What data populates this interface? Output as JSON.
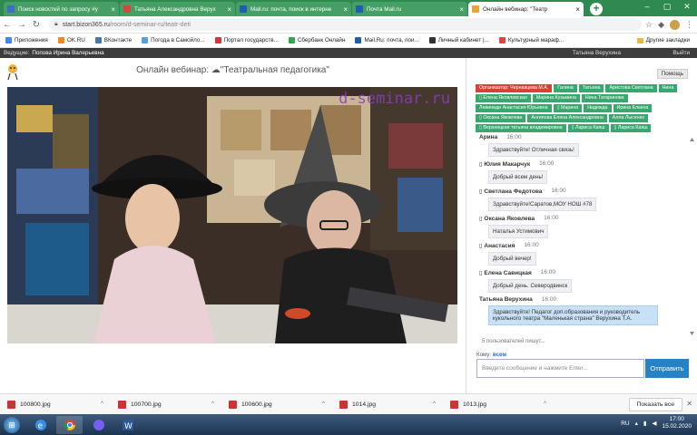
{
  "tabs": [
    {
      "label": "Поиск новостей по запросу #у",
      "color": "#3b6cc8",
      "active": false
    },
    {
      "label": "Татьяна Александровна Верух",
      "color": "#d44a3a",
      "active": false
    },
    {
      "label": "Mail.ru: почта, поиск в интерне",
      "color": "#1a5fb4",
      "active": false
    },
    {
      "label": "Почта Mail.ru",
      "color": "#1a5fb4",
      "active": false
    },
    {
      "label": "Онлайн вебинар: \"Театр",
      "color": "#e8a33a",
      "active": true
    }
  ],
  "address": {
    "host": "start.bizon365.ru",
    "path": "/room/d-seminar-ru/teatr-deti"
  },
  "bookmarks": [
    {
      "label": "Приложения",
      "color": "#4285f4"
    },
    {
      "label": "OK.RU",
      "color": "#f28a1e"
    },
    {
      "label": "ВКонтакте",
      "color": "#4a76a8"
    },
    {
      "label": "Погода в Самойло...",
      "color": "#5aa0d8"
    },
    {
      "label": "Портал государств...",
      "color": "#d33"
    },
    {
      "label": "Сбербанк Онлайн",
      "color": "#2fa84f"
    },
    {
      "label": "Mail.Ru: почта, пои...",
      "color": "#1a5fb4"
    },
    {
      "label": "Личный кабинет |...",
      "color": "#333"
    },
    {
      "label": "Культурный мараф...",
      "color": "#d44"
    }
  ],
  "other_bookmarks": "Другие закладки",
  "site": {
    "host_label": "Ведущие:",
    "host_name": "Попова Ирина Валерьевна",
    "user": "Татьяна Верухина",
    "exit": "Выйти"
  },
  "webinar_title": "Онлайн вебинар: ☁\"Театральная педагогика\"",
  "watermark": "d-seminar.ru",
  "chat": {
    "help": "Помощь",
    "participants": [
      {
        "label": "Организатор: Чернавцева М.А.",
        "org": true
      },
      {
        "label": "Галина"
      },
      {
        "label": "Татьяна"
      },
      {
        "label": "Аристова Светлана"
      },
      {
        "label": "Нина"
      },
      {
        "label": "▯ Елена Яковлевская"
      },
      {
        "label": "Марина Кузьмина"
      },
      {
        "label": "Нина Татаринова"
      },
      {
        "label": "Левиниди Анастасия Юрьевна"
      },
      {
        "label": "▯ Марина"
      },
      {
        "label": "Надежда"
      },
      {
        "label": "Ирина Елкина"
      },
      {
        "label": "▯ Оксана Яковлева"
      },
      {
        "label": "Ангипова Елена Александровна"
      },
      {
        "label": "Алла Лысенко"
      },
      {
        "label": "▯ Верхнецкая татьяна владимировна"
      },
      {
        "label": "▯ Лариса Каяш"
      },
      {
        "label": "▯ Лариса Каяш"
      }
    ],
    "messages": [
      {
        "author": "Арина",
        "time": "16:00",
        "text": "Здравствуйте! Отличная связь!",
        "own": false
      },
      {
        "author": "▯ Юлия Макарчук",
        "time": "16:00",
        "text": "Добрый всем день!",
        "own": false
      },
      {
        "author": "▯ Светлана Федотова",
        "time": "16:00",
        "text": "Здравствуйте!Саратов,МОУ НОШ #78",
        "own": false
      },
      {
        "author": "▯ Оксана Яковлева",
        "time": "16:00",
        "text": "Наталья Устимович",
        "own": false
      },
      {
        "author": "▯ Анастасия",
        "time": "16:00",
        "text": "Добрый вечер!",
        "own": false
      },
      {
        "author": "▯ Елена Савицкая",
        "time": "16:00",
        "text": "Добрый день. Северодвинск",
        "own": false
      },
      {
        "author": "Татьяна Верухина",
        "time": "16:00",
        "text": "Здравствуйте! Педагог доп.образования и руководитель кукольного театра \"Маленькая страна\" Верухина Т.А.",
        "own": true
      }
    ],
    "typing": "5 пользователей пишут...",
    "to_label": "Кому:",
    "to_value": "всем",
    "input_placeholder": "Введите сообщение и нажмите Enter...",
    "send": "Отправить"
  },
  "downloads": [
    {
      "name": "100800.jpg"
    },
    {
      "name": "100700.jpg"
    },
    {
      "name": "100600.jpg"
    },
    {
      "name": "1014.jpg"
    },
    {
      "name": "1013.jpg"
    }
  ],
  "show_all": "Показать все",
  "tray": {
    "lang": "RU",
    "time": "17:00",
    "date": "15.02.2020"
  }
}
